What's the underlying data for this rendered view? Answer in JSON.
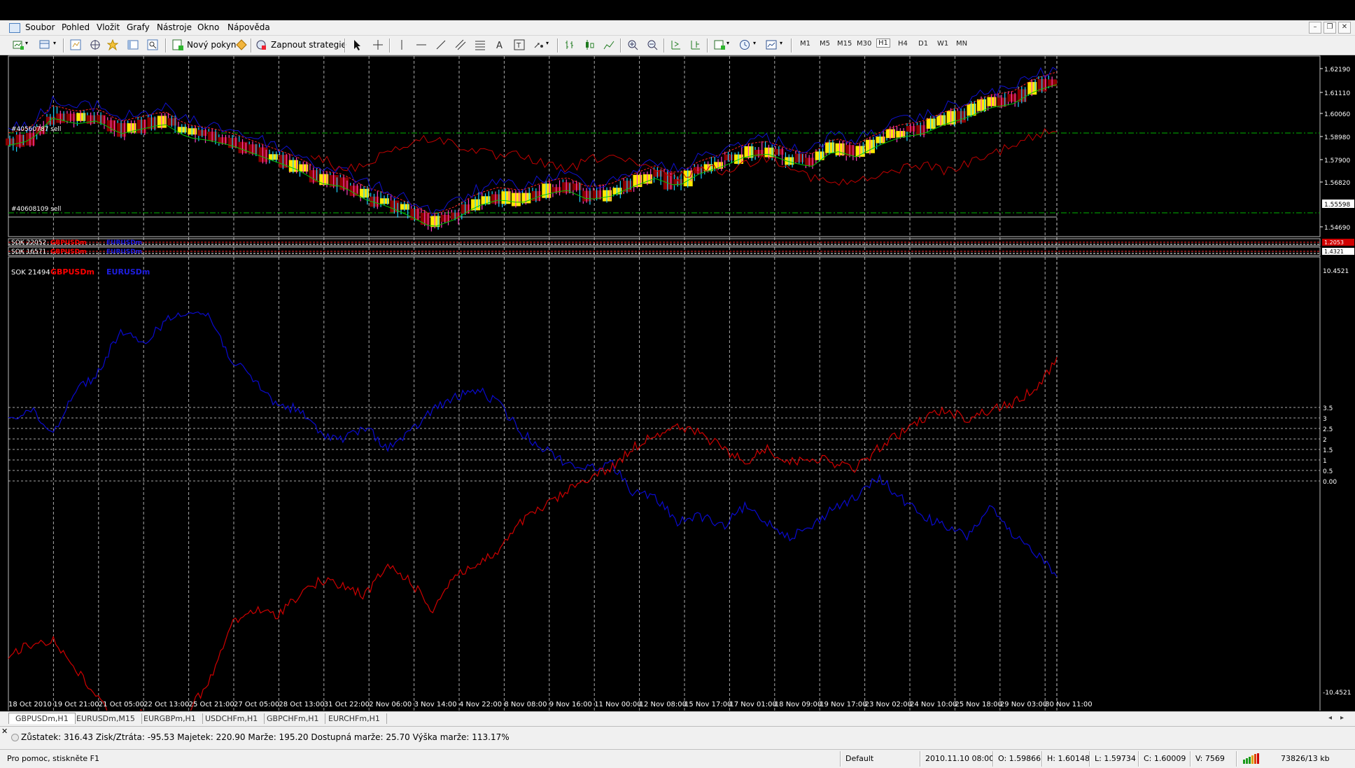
{
  "menu": {
    "items": [
      "Soubor",
      "Pohled",
      "Vložit",
      "Grafy",
      "Nástroje",
      "Okno",
      "Nápověda"
    ]
  },
  "toolbar": {
    "new_order_label": "Nový pokyn",
    "strategies_label": "Zapnout strategie",
    "timeframes": [
      "M1",
      "M5",
      "M15",
      "M30",
      "H1",
      "H4",
      "D1",
      "W1",
      "MN"
    ],
    "active_timeframe": "H1"
  },
  "chart": {
    "main": {
      "price_labels": [
        "1.62190",
        "1.61110",
        "1.60060",
        "1.58980",
        "1.57900",
        "1.56820",
        "1.55598",
        "1.54690"
      ],
      "order_lines": [
        {
          "label": "#40560787 sell",
          "color": "#00b400"
        },
        {
          "label": "#40608109 sell",
          "color": "#00b400"
        }
      ],
      "current_price": "1.55598"
    },
    "sub1": {
      "label": "SOK 22052",
      "symbols": [
        "GBPUSDm",
        "EURUSDm"
      ],
      "scale_value": "1.2053"
    },
    "sub2": {
      "label": "SOK 16571",
      "symbols": [
        "GBPUSDm",
        "EURUSDm"
      ],
      "scale_value": "1.4321"
    },
    "sub3": {
      "label": "SOK 21494",
      "symbol_1": "GBPUSDm",
      "symbol_2": "EURUSDm",
      "symbol_1_color": "#ff0000",
      "symbol_2_color": "#1e1ee0",
      "scale_top": "10.4521",
      "scale_bottom": "-10.4521",
      "level_labels": [
        "3.5",
        "3",
        "2.5",
        "2",
        "1.5",
        "1",
        "0.5",
        "0.00"
      ]
    },
    "time_labels": [
      "18 Oct 2010",
      "19 Oct 21:00",
      "21 Oct 05:00",
      "22 Oct 13:00",
      "25 Oct 21:00",
      "27 Oct 05:00",
      "28 Oct 13:00",
      "31 Oct 22:00",
      "2 Nov 06:00",
      "3 Nov 14:00",
      "4 Nov 22:00",
      "8 Nov 08:00",
      "9 Nov 16:00",
      "11 Nov 00:00",
      "12 Nov 08:00",
      "15 Nov 17:00",
      "17 Nov 01:00",
      "18 Nov 09:00",
      "19 Nov 17:00",
      "23 Nov 02:00",
      "24 Nov 10:00",
      "25 Nov 18:00",
      "29 Nov 03:00",
      "30 Nov 11:00"
    ]
  },
  "tabs": {
    "items": [
      "GBPUSDm,H1",
      "EURUSDm,M15",
      "EURGBPm,H1",
      "USDCHFm,H1",
      "GBPCHFm,H1",
      "EURCHFm,H1"
    ],
    "active": "GBPUSDm,H1"
  },
  "terminal": {
    "account_line": "Zůstatek: 316.43  Zisk/Ztráta: -95.53  Majetek: 220.90  Marže: 195.20  Dostupná marže: 25.70  Výška marže: 113.17%"
  },
  "status": {
    "help": "Pro pomoc, stiskněte F1",
    "profile": "Default",
    "datetime": "2010.11.10 08:00",
    "open": "O: 1.59866",
    "high": "H: 1.60148",
    "low": "L: 1.59734",
    "close": "C: 1.60009",
    "volume": "V: 7569",
    "traffic": "73826/13 kb"
  },
  "colors": {
    "background": "#000000",
    "grid": "#c8c8c8",
    "bull_candle": "#ffe800",
    "bear_candle": "#8b0000",
    "series_red": "#ff0000",
    "series_blue": "#1e1ee0",
    "ma_green": "#00c800",
    "ma_red": "#ff2020"
  }
}
